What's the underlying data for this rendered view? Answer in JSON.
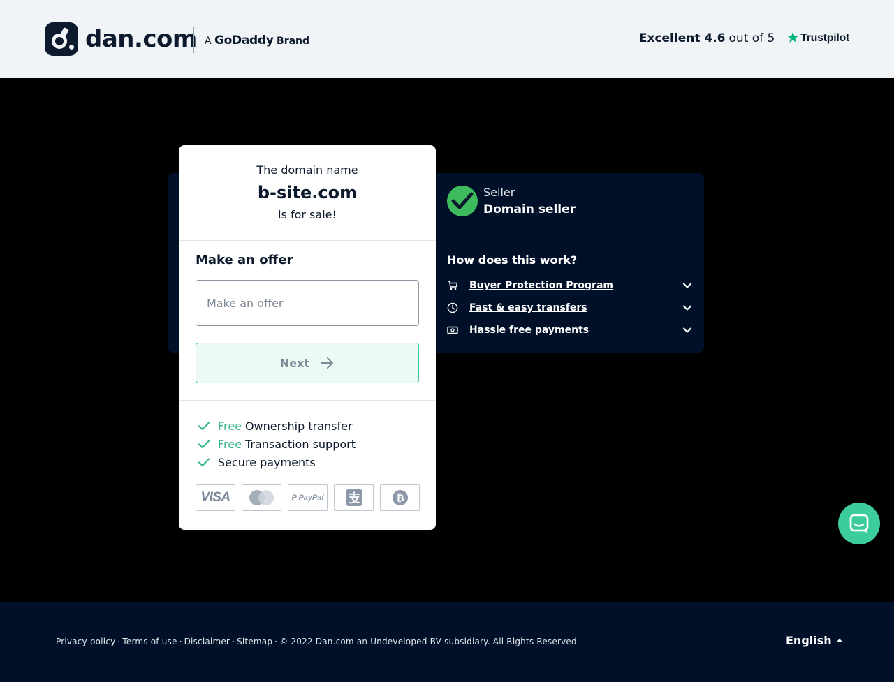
{
  "header": {
    "logo_text": "dan.com",
    "brand_prefix": "A",
    "brand_name": "GoDaddy",
    "brand_suffix": "Brand",
    "trust_score": "Excellent 4.6",
    "trust_rest": "out of 5",
    "trust_provider": "Trustpilot"
  },
  "offer_card": {
    "intro": "The domain name",
    "domain": "b-site.com",
    "status": "is for sale!",
    "offer_label": "Make an offer",
    "offer_placeholder": "Make an offer",
    "next_label": "Next",
    "features": [
      {
        "free": "Free",
        "text": "Ownership transfer"
      },
      {
        "free": "Free",
        "text": "Transaction support"
      },
      {
        "free": "",
        "text": "Secure payments"
      }
    ],
    "payment_methods": [
      "VISA",
      "Mastercard",
      "PayPal",
      "Alipay",
      "Bitcoin"
    ],
    "payment_labels": {
      "visa": "VISA",
      "paypal": "P PayPal"
    }
  },
  "seller_panel": {
    "label": "Seller",
    "name": "Domain seller",
    "how_title": "How does this work?",
    "items": [
      {
        "label": "Buyer Protection Program",
        "icon": "cart-icon"
      },
      {
        "label": "Fast & easy transfers",
        "icon": "clock-icon"
      },
      {
        "label": "Hassle free payments",
        "icon": "banknote-icon"
      }
    ]
  },
  "footer": {
    "links": [
      "Privacy policy",
      "Terms of use",
      "Disclaimer",
      "Sitemap"
    ],
    "separator": "·",
    "copyright": "© 2022 Dan.com an Undeveloped BV subsidiary. All Rights Reserved.",
    "language": "English"
  },
  "colors": {
    "accent": "#3ccd9b",
    "navy": "#001029",
    "seller_check": "#3dbb5d",
    "trustpilot_star": "#00b67a"
  }
}
